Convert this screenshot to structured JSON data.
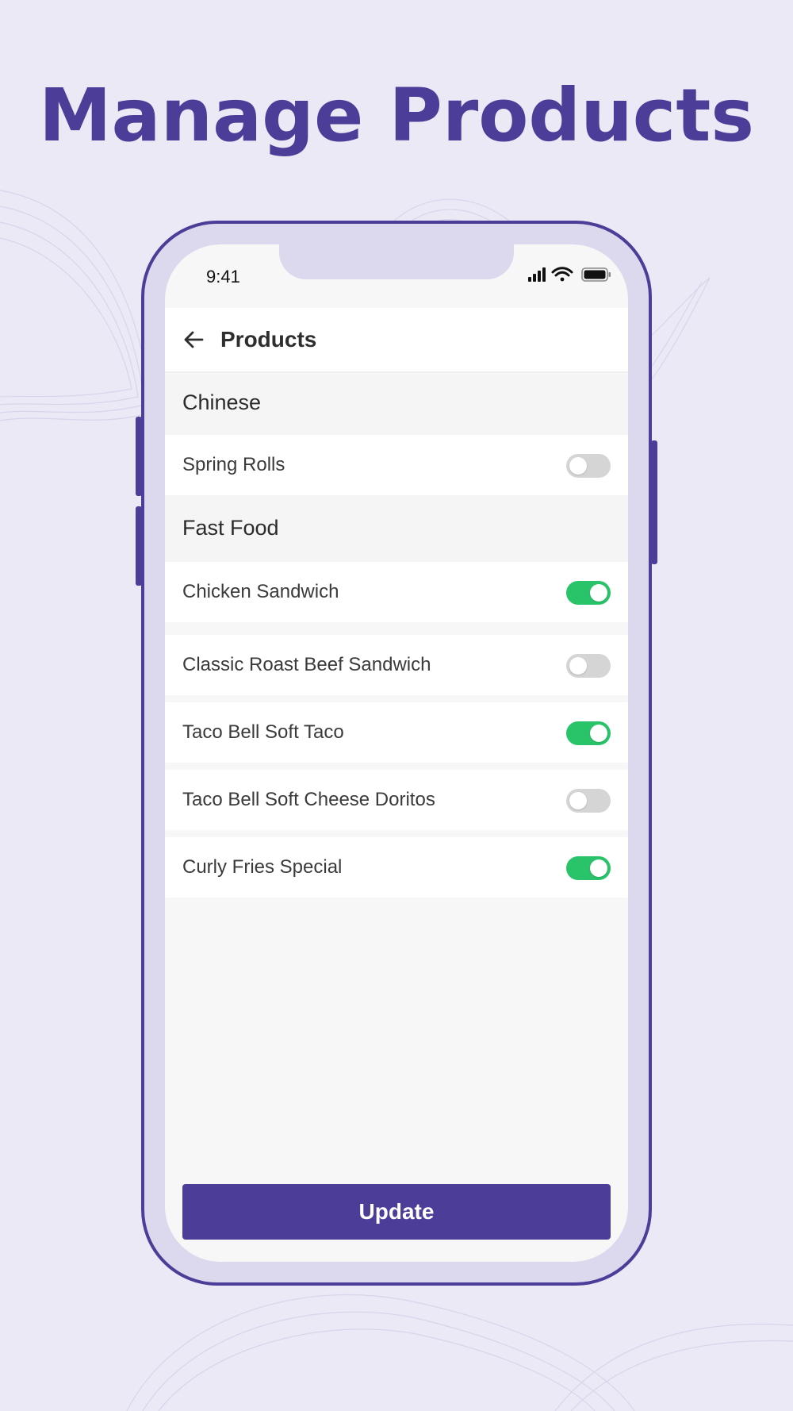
{
  "headline": "Manage Products",
  "status_bar": {
    "time": "9:41",
    "icons": [
      "signal-icon",
      "wifi-icon",
      "battery-icon"
    ]
  },
  "appbar": {
    "back_icon": "arrow-left-icon",
    "title": "Products"
  },
  "sections": [
    {
      "label": "Chinese",
      "items": [
        {
          "label": "Spring Rolls",
          "enabled": false
        }
      ]
    },
    {
      "label": "Fast Food",
      "items": [
        {
          "label": "Chicken Sandwich",
          "enabled": true
        },
        {
          "label": "Classic Roast Beef Sandwich",
          "enabled": false
        },
        {
          "label": "Taco Bell Soft Taco",
          "enabled": true
        },
        {
          "label": "Taco Bell Soft Cheese Doritos",
          "enabled": false
        },
        {
          "label": "Curly Fries Special",
          "enabled": true
        }
      ]
    }
  ],
  "update_button": "Update",
  "colors": {
    "brand": "#4b3d98",
    "toggle_on": "#29c46a",
    "toggle_off": "#d5d5d5",
    "background": "#ebe9f5"
  }
}
